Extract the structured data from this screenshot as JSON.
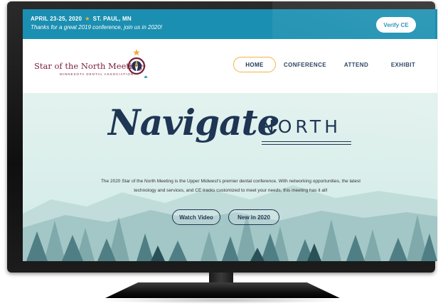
{
  "topbar": {
    "event_date": "APRIL 23-25, 2020",
    "event_location": "ST. PAUL, MN",
    "thanks_message": "Thanks for a great 2019 conference, join us in 2020!",
    "verify_label": "Verify CE"
  },
  "logo": {
    "title": "Star of the North Meeting",
    "subtitle": "MINNESOTA DENTAL ASSOCIATION"
  },
  "nav": {
    "items": [
      {
        "label": "HOME",
        "active": true
      },
      {
        "label": "CONFERENCE",
        "active": false
      },
      {
        "label": "ATTEND",
        "active": false
      },
      {
        "label": "EXHIBIT",
        "active": false
      }
    ]
  },
  "hero": {
    "headline_script": "Navigate",
    "headline_caps": "NORTH",
    "description": "The 2020 Star of the North Meeting is the Upper Midwest's premier dental conference. With networking opportunities, the latest technology and services, and CE tracks customized to meet your needs, this meeting has it all!",
    "buttons": [
      {
        "label": "Watch Video"
      },
      {
        "label": "New in 2020"
      }
    ]
  },
  "colors": {
    "topbar_bg": "#1b8fb1",
    "accent_orange": "#f2b24a",
    "navy": "#1e3554",
    "maroon": "#7a1c3a"
  }
}
